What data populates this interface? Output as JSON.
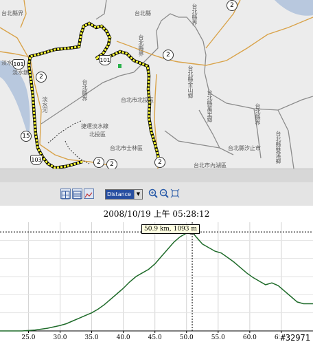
{
  "map": {
    "labels": [
      "台北縣界",
      "台北縣",
      "淡水鎮",
      "台北縣界",
      "台北縣界",
      "淡水河",
      "捷運淡水線",
      "北投區",
      "台北市北投區",
      "台北市士林區",
      "台北縣金山鄉",
      "台北縣萬里鄉",
      "台北縣汐止市",
      "台北市內湖區",
      "台北縣雙溪鄉",
      "台北縣界",
      "淡水",
      "台北縣界"
    ],
    "shields": [
      "2",
      "2",
      "2",
      "2",
      "2",
      "2",
      "15",
      "101",
      "101",
      "103"
    ]
  },
  "toolbar": {
    "distance_select": "Distance",
    "icons": [
      "chart-view-1-icon",
      "chart-view-2-icon",
      "chart-view-3-icon",
      "zoom-in-icon",
      "zoom-out-icon",
      "zoom-fit-icon"
    ]
  },
  "chart": {
    "title": "2008/10/19 上午 05:28:12",
    "tooltip": "50.9 km, 1093 m",
    "watermark": "#32971"
  },
  "chart_data": {
    "type": "line",
    "title": "2008/10/19 上午 05:28:12",
    "xlabel": "",
    "ylabel": "",
    "x_ticks": [
      "25.0",
      "30.0",
      "35.0",
      "40.0",
      "45.0",
      "50.0",
      "55.0",
      "60.0",
      "65.0"
    ],
    "xlim": [
      20.5,
      70.0
    ],
    "ylim": [
      0,
      1200
    ],
    "grid": true,
    "series": [
      {
        "name": "",
        "x": [
          20.5,
          22,
          24,
          26,
          28,
          30,
          31,
          32,
          33,
          34,
          35,
          36,
          37,
          38,
          39,
          40,
          41,
          42,
          43,
          44,
          45,
          46,
          47,
          48,
          49,
          50,
          50.9,
          51.5,
          52.5,
          53.5,
          54.5,
          55.5,
          56.5,
          57.5,
          58.5,
          59.5,
          60.5,
          61.5,
          62.5,
          63.5,
          64.5,
          65.5,
          66.5,
          67.5,
          68.5,
          70
        ],
        "y": [
          0,
          0,
          0,
          10,
          30,
          60,
          80,
          110,
          140,
          170,
          200,
          240,
          290,
          350,
          410,
          470,
          540,
          600,
          640,
          680,
          740,
          820,
          900,
          980,
          1040,
          1080,
          1093,
          1040,
          960,
          920,
          880,
          860,
          810,
          760,
          700,
          640,
          590,
          550,
          510,
          530,
          500,
          440,
          380,
          320,
          300,
          300
        ]
      }
    ],
    "marker_x": 50.9,
    "marker_y": 1093
  }
}
